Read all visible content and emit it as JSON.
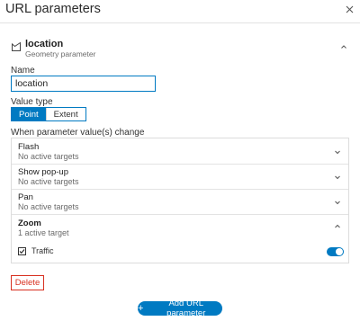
{
  "dialog": {
    "title": "URL parameters"
  },
  "parameter": {
    "name": "location",
    "type_label": "Geometry parameter"
  },
  "form": {
    "name_label": "Name",
    "name_value": "location",
    "value_type_label": "Value type",
    "value_type_options": [
      "Point",
      "Extent"
    ],
    "value_type_selected": "Point",
    "change_label": "When parameter value(s) change"
  },
  "actions": [
    {
      "title": "Flash",
      "status": "No active targets",
      "expanded": false
    },
    {
      "title": "Show pop-up",
      "status": "No active targets",
      "expanded": false
    },
    {
      "title": "Pan",
      "status": "No active targets",
      "expanded": false
    },
    {
      "title": "Zoom",
      "status": "1 active target",
      "expanded": true
    }
  ],
  "zoom_target": {
    "label": "Traffic",
    "enabled": true
  },
  "buttons": {
    "delete": "Delete",
    "add_plus": "+",
    "add": "Add URL parameter"
  },
  "colors": {
    "accent": "#007ac2",
    "danger": "#d83020"
  }
}
